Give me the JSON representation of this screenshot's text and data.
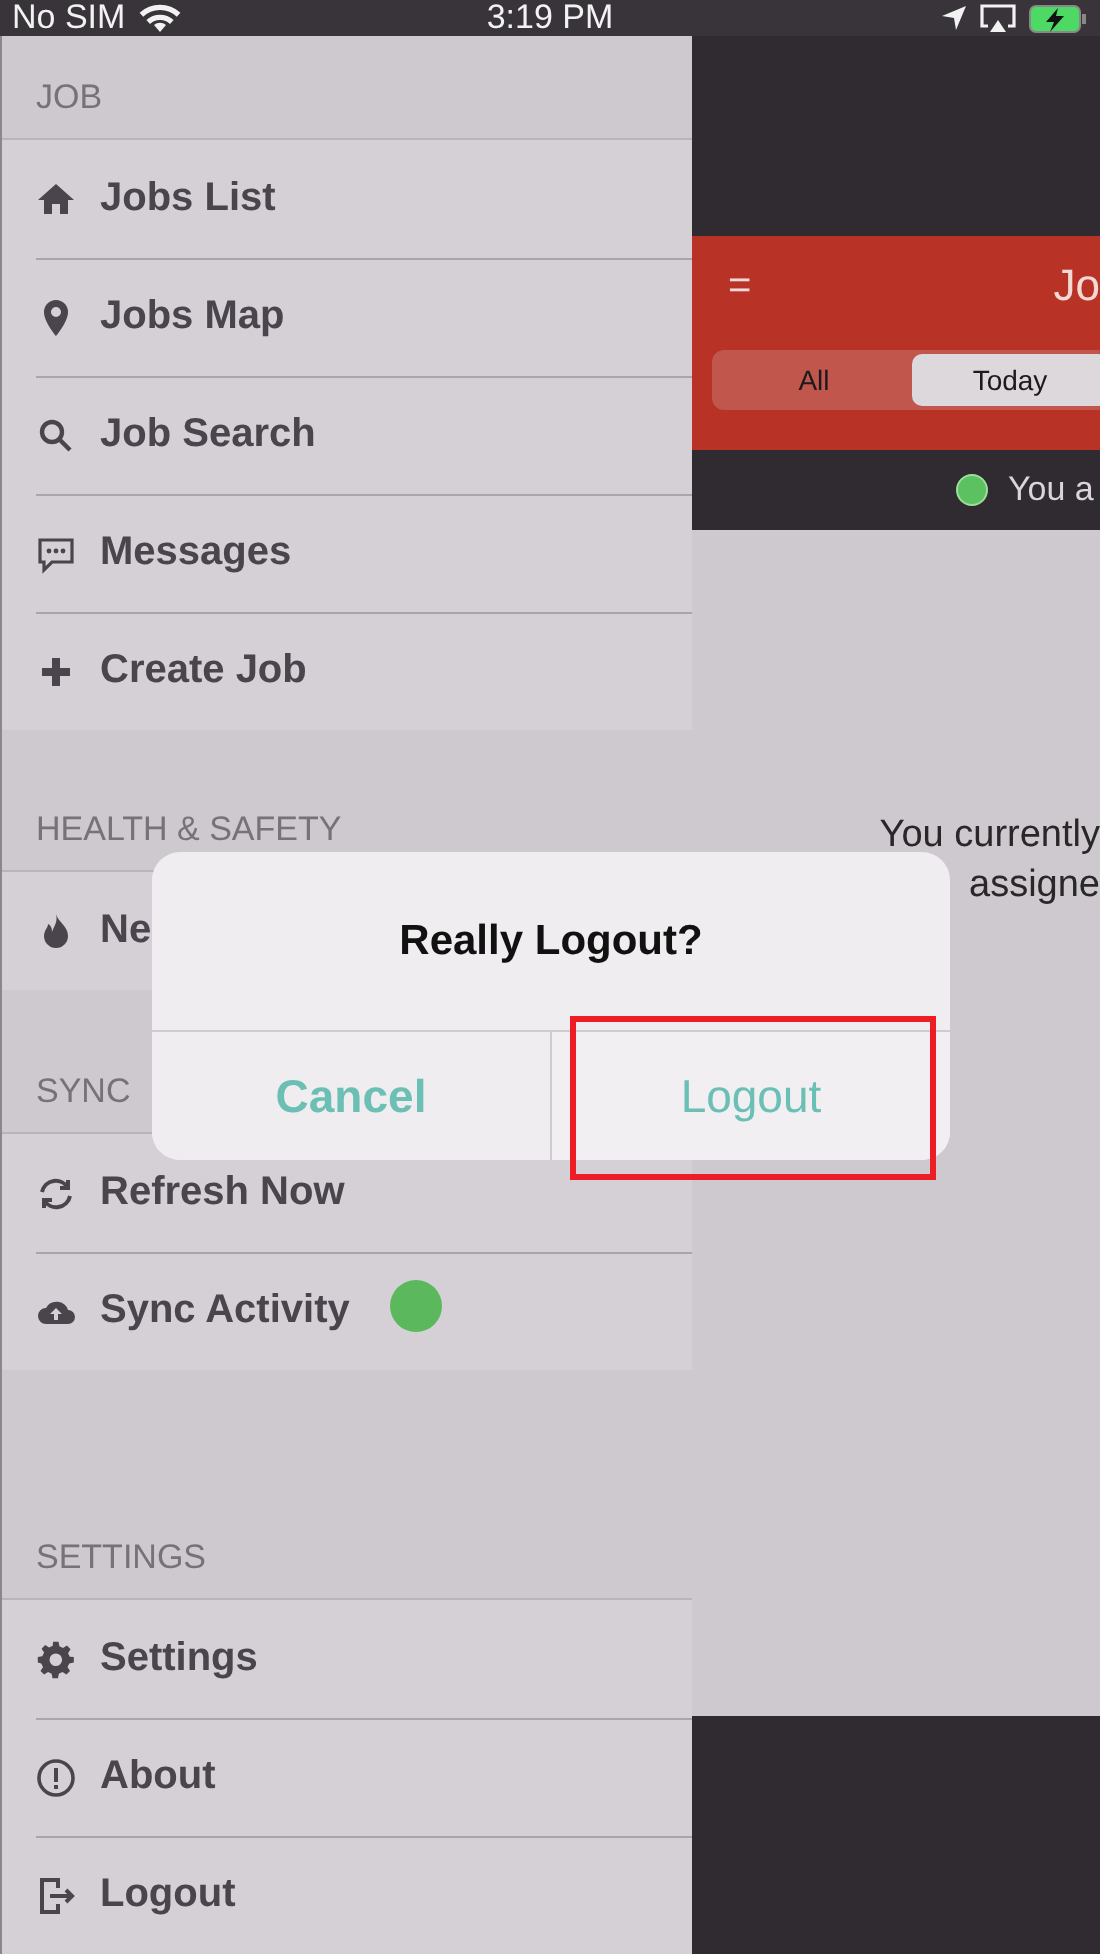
{
  "status_bar": {
    "carrier": "No SIM",
    "time": "3:19 PM"
  },
  "menu": {
    "sections": [
      {
        "title": "JOB",
        "items": [
          {
            "label": "Jobs List"
          },
          {
            "label": "Jobs Map"
          },
          {
            "label": "Job Search"
          },
          {
            "label": "Messages"
          },
          {
            "label": "Create Job"
          }
        ]
      },
      {
        "title": "HEALTH & SAFETY",
        "items": [
          {
            "label": "Ne"
          }
        ]
      },
      {
        "title": "SYNC",
        "items": [
          {
            "label": "Refresh Now"
          },
          {
            "label": "Sync Activity",
            "color": "#5cb85c"
          }
        ]
      },
      {
        "title": "SETTINGS",
        "items": [
          {
            "label": "Settings"
          },
          {
            "label": "About"
          },
          {
            "label": "Logout"
          }
        ]
      }
    ]
  },
  "background_screen": {
    "menu_glyph": "=",
    "title": "Jo",
    "tabs": [
      {
        "label": "All",
        "selected": false
      },
      {
        "label": "Today",
        "selected": true
      }
    ],
    "status_text": "You a",
    "message_lines": [
      "You currently",
      "assigne"
    ]
  },
  "dialog": {
    "title": "Really Logout?",
    "buttons": [
      {
        "label": "Cancel",
        "kind": "cancel",
        "highlighted": false
      },
      {
        "label": "Logout",
        "kind": "confirm",
        "highlighted": true
      }
    ]
  }
}
